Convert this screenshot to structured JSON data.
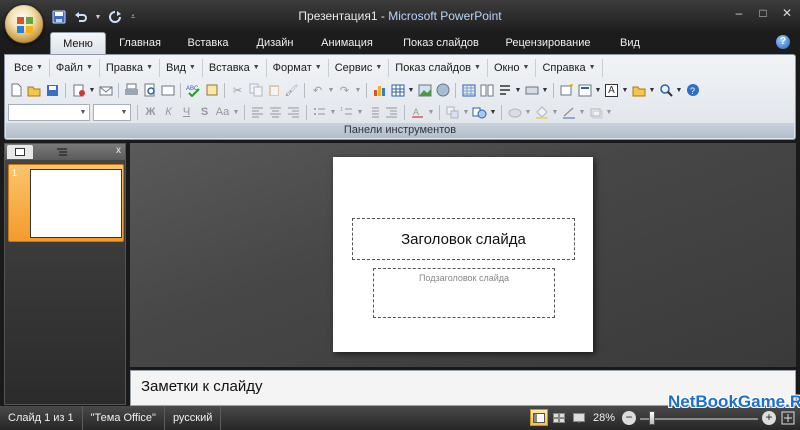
{
  "window": {
    "doc_title": "Презентация1",
    "separator": " - ",
    "app_title": "Microsoft PowerPoint",
    "minimize": "–",
    "maximize": "□",
    "close": "✕"
  },
  "quick_access": [
    "save-icon",
    "undo-icon",
    "redo-icon",
    "customize-icon"
  ],
  "tabs": [
    {
      "label": "Меню",
      "active": true
    },
    {
      "label": "Главная"
    },
    {
      "label": "Вставка"
    },
    {
      "label": "Дизайн"
    },
    {
      "label": "Анимация"
    },
    {
      "label": "Показ слайдов"
    },
    {
      "label": "Рецензирование"
    },
    {
      "label": "Вид"
    }
  ],
  "help": "?",
  "ribbon": {
    "menus": [
      "Все",
      "Файл",
      "Правка",
      "Вид",
      "Вставка",
      "Формат",
      "Сервис",
      "Показ слайдов",
      "Окно",
      "Справка"
    ],
    "group_label": "Панели инструментов",
    "format_buttons": {
      "bold": "Ж",
      "italic": "К",
      "underline": "Ч",
      "shadow": "S",
      "case": "Аа"
    },
    "text_box_letter": "A"
  },
  "slides_pane": {
    "close": "x",
    "slide_number": "1"
  },
  "slide": {
    "title_placeholder": "Заголовок слайда",
    "subtitle_placeholder": "Подзаголовок слайда"
  },
  "notes": {
    "placeholder": "Заметки к слайду"
  },
  "status": {
    "slide_info": "Слайд 1 из 1",
    "theme": "\"Тема Office\"",
    "language": "русский",
    "zoom": "28%",
    "zoom_level": 0.28,
    "zoom_minus": "−",
    "zoom_plus": "+"
  },
  "watermark": "NetBookGame.Ru",
  "colors": {
    "ribbon_bg": "#e6eaef",
    "active_thumb": "#f6a93a",
    "accent_blue": "#1b6fd1"
  }
}
